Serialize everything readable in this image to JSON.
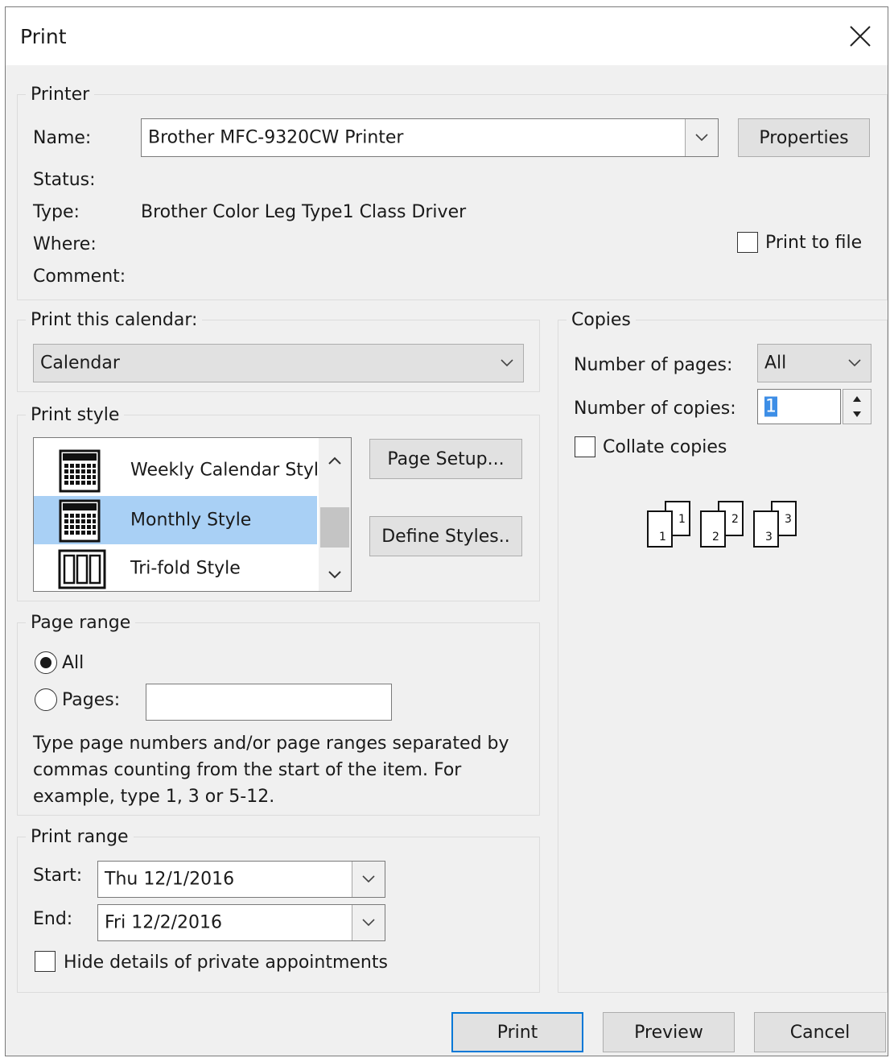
{
  "window": {
    "title": "Print"
  },
  "printer": {
    "group_label": "Printer",
    "name_label": "Name:",
    "name_value": "Brother MFC-9320CW Printer",
    "properties_label": "Properties",
    "status_label": "Status:",
    "type_label": "Type:",
    "type_value": "Brother Color Leg Type1 Class Driver",
    "where_label": "Where:",
    "comment_label": "Comment:",
    "print_to_file_label": "Print to file"
  },
  "calendar": {
    "group_label": "Print this calendar:",
    "selected": "Calendar"
  },
  "print_style": {
    "group_label": "Print style",
    "items": [
      {
        "label": "Weekly Calendar Styl",
        "icon": "weekly-calendar-icon"
      },
      {
        "label": "Monthly Style",
        "icon": "monthly-calendar-icon"
      },
      {
        "label": "Tri-fold Style",
        "icon": "trifold-icon"
      }
    ],
    "selected_index": 1,
    "page_setup_label": "Page Setup...",
    "define_styles_label": "Define Styles.."
  },
  "copies": {
    "group_label": "Copies",
    "pages_label": "Number of pages:",
    "pages_value": "All",
    "copies_label": "Number of copies:",
    "copies_value": "1",
    "collate_label": "Collate copies",
    "collate_icon": "collate-pages-icon"
  },
  "page_range": {
    "group_label": "Page range",
    "all_label": "All",
    "pages_label": "Pages:",
    "pages_value": "",
    "help_text": "Type page numbers and/or page ranges separated by commas counting from the start of the item.  For example, type 1, 3 or 5-12."
  },
  "print_range": {
    "group_label": "Print range",
    "start_label": "Start:",
    "start_value": "Thu 12/1/2016",
    "end_label": "End:",
    "end_value": "Fri 12/2/2016",
    "hide_private_label": "Hide details of private appointments"
  },
  "footer": {
    "print_label": "Print",
    "preview_label": "Preview",
    "cancel_label": "Cancel"
  }
}
